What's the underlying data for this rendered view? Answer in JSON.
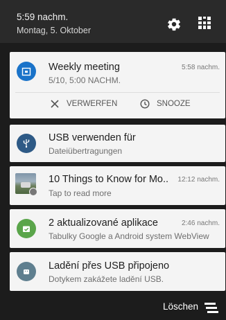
{
  "status": {
    "time": "5:59 nachm.",
    "date": "Montag, 5. Oktober"
  },
  "notifications": [
    {
      "icon": "calendar-icon",
      "color": "#1a73c9",
      "title": "Weekly meeting",
      "text": "5/10, 5:00 NACHM.",
      "time": "5:58 nachm.",
      "actions": [
        "VERWERFEN",
        "SNOOZE"
      ]
    },
    {
      "icon": "usb-icon",
      "color": "#2e5a86",
      "title": "USB verwenden für",
      "text": "Dateiübertragungen",
      "time": ""
    },
    {
      "icon": "article-thumbnail",
      "color": "#4a6a3a",
      "title": "10 Things to Know for Mo..",
      "text": "Tap to read more",
      "time": "12:12 nachm."
    },
    {
      "icon": "play-store-update-icon",
      "color": "#5aa54a",
      "title": "2 aktualizované aplikace",
      "text": "Tabulky Google a Android system WebView",
      "time": "2:46 nachm."
    },
    {
      "icon": "android-debug-icon",
      "color": "#5f7f8f",
      "title": "Ladění přes USB připojeno",
      "text": "Dotykem zakážete ladění USB.",
      "time": ""
    }
  ],
  "footer": {
    "clear_label": "Löschen"
  }
}
